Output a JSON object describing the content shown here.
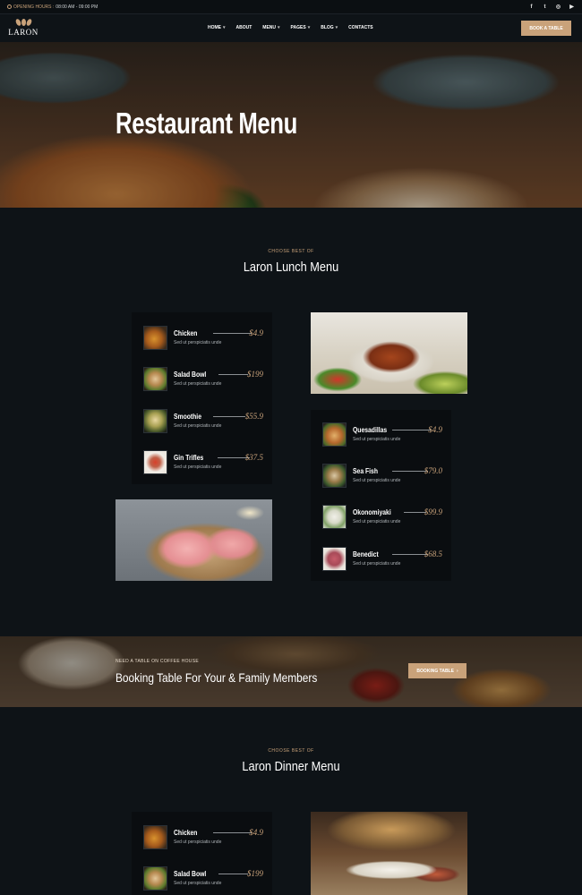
{
  "topbar": {
    "hours_label": "OPENING HOURS :",
    "hours_value": "08:00 AM - 09:00 PM",
    "social": [
      "f",
      "t",
      "◎",
      "▶"
    ]
  },
  "header": {
    "logo_text": "LARON",
    "nav": [
      {
        "label": "HOME",
        "dropdown": true
      },
      {
        "label": "ABOUT",
        "dropdown": false
      },
      {
        "label": "MENU",
        "dropdown": true
      },
      {
        "label": "PAGES",
        "dropdown": true
      },
      {
        "label": "BLOG",
        "dropdown": true
      },
      {
        "label": "CONTACTS",
        "dropdown": false
      }
    ],
    "book_button": "BOOK A TABLE"
  },
  "hero": {
    "title": "Restaurant Menu"
  },
  "lunch": {
    "subtitle": "CHOOSE BEST OF",
    "title": "Laron Lunch Menu",
    "left_items": [
      {
        "name": "Chicken",
        "desc": "Sed ut perspiciatis unde",
        "price": "$4.9"
      },
      {
        "name": "Salad Bowl",
        "desc": "Sed ut perspiciatis unde",
        "price": "$199"
      },
      {
        "name": "Smoothie",
        "desc": "Sed ut perspiciatis unde",
        "price": "$55.9"
      },
      {
        "name": "Gin Trifles",
        "desc": "Sed ut perspiciatis unde",
        "price": "$37.5"
      }
    ],
    "right_items": [
      {
        "name": "Quesadillas",
        "desc": "Sed ut perspiciatis unde",
        "price": "$4.9"
      },
      {
        "name": "Sea Fish",
        "desc": "Sed ut perspiciatis unde",
        "price": "$79.0"
      },
      {
        "name": "Okonomiyaki",
        "desc": "Sed ut perspiciatis unde",
        "price": "$99.9"
      },
      {
        "name": "Benedict",
        "desc": "Sed ut perspiciatis unde",
        "price": "$68.5"
      }
    ]
  },
  "booking": {
    "subtitle": "NEED A TABLE ON COFFEE HOUSE",
    "title": "Booking Table For Your & Family Members",
    "button": "BOOKING TABLE"
  },
  "dinner": {
    "subtitle": "CHOOSE BEST OF",
    "title": "Laron Dinner Menu",
    "left_items": [
      {
        "name": "Chicken",
        "desc": "Sed ut perspiciatis unde",
        "price": "$4.9"
      },
      {
        "name": "Salad Bowl",
        "desc": "Sed ut perspiciatis unde",
        "price": "$199"
      }
    ]
  },
  "colors": {
    "accent": "#c9a27a",
    "background": "#0e1317",
    "card": "#0a0d10"
  }
}
